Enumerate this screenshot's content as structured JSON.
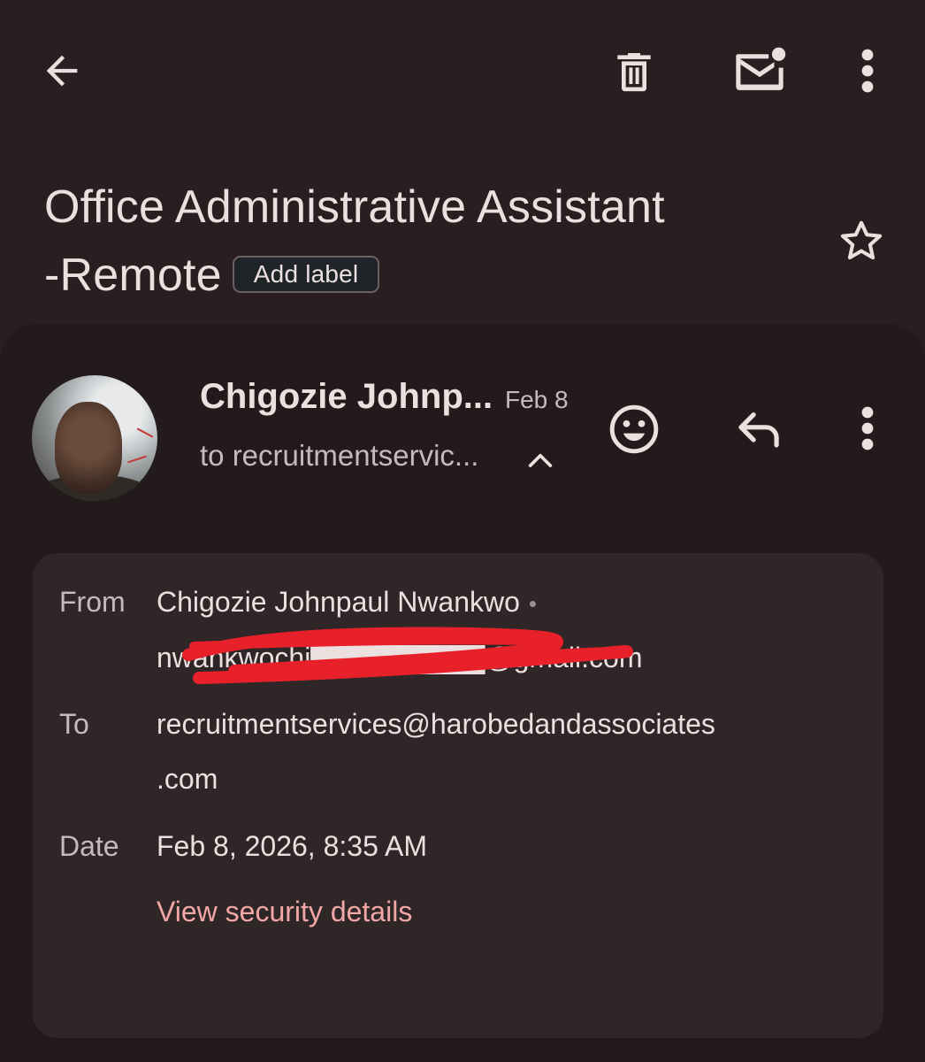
{
  "toolbar": {
    "back_icon": "arrow-left-icon",
    "delete_icon": "trash-icon",
    "mark_unread_icon": "mail-unread-icon",
    "more_icon": "more-vertical-icon"
  },
  "subject": {
    "line1": "Office Administrative Assistant",
    "line2": "-Remote",
    "add_label": "Add label",
    "star_icon": "star-outline-icon"
  },
  "message": {
    "sender_name": "Chigozie Johnp...",
    "date": "Feb 8",
    "to_summary": "to recruitmentservic...",
    "emoji_icon": "emoji-reaction-icon",
    "reply_icon": "reply-icon",
    "more_icon": "more-vertical-icon"
  },
  "details": {
    "from_label": "From",
    "from_name": "Chigozie Johnpaul Nwankwo",
    "from_separator": "•",
    "from_email": "nwankwochi▇▇▇▇▇▇▇▇@gmail.com",
    "to_label": "To",
    "to_line1": "recruitmentservices@harobedandassociates",
    "to_line2": ".com",
    "date_label": "Date",
    "date_value": "Feb 8, 2026, 8:35 AM",
    "security_link": "View security details"
  },
  "colors": {
    "background": "#2a1f20",
    "card": "#231a1b",
    "details_box": "#2f2627",
    "text_primary": "#ecdfe0",
    "text_secondary": "#c8babc",
    "link": "#f2a7a6",
    "redaction": "#e8202a"
  }
}
